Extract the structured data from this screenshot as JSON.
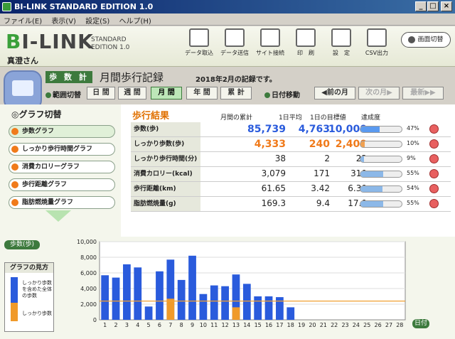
{
  "window": {
    "title": "BI-LINK STANDARD EDITION 1.0",
    "min": "_",
    "max": "□",
    "close": "×"
  },
  "menu": [
    "ファイル(E)",
    "表示(V)",
    "設定(S)",
    "ヘルプ(H)"
  ],
  "header": {
    "logo": "BI-LINK",
    "edition_line1": "STANDARD",
    "edition_line2": "EDITION 1.0",
    "user": "真澄さん",
    "tools": [
      "データ取込",
      "データ送信",
      "サイト接続",
      "印　刷",
      "設　定",
      "CSV出力"
    ],
    "screen_switch": "画面切替"
  },
  "page": {
    "label": "歩 数 計",
    "title": "月間歩行記録",
    "subtitle": "2018年2月の記録です。"
  },
  "range": {
    "label": "範囲切替",
    "tabs": [
      "日 間",
      "週 間",
      "月 間",
      "年 間",
      "累 計"
    ],
    "active": 2
  },
  "date_move": {
    "label": "日付移動",
    "prev": "前の月",
    "next": "次の月",
    "latest": "最新"
  },
  "graph_switch": {
    "title": "グラフ切替",
    "items": [
      "歩数グラフ",
      "しっかり歩行時間グラフ",
      "消費カロリーグラフ",
      "歩行距離グラフ",
      "脂肪燃焼量グラフ"
    ],
    "active": 0
  },
  "results": {
    "title": "歩行結果",
    "headers": [
      "月間の累計",
      "1日平均",
      "1日の目標値",
      "達成度"
    ],
    "rows": [
      {
        "name": "歩数(歩)",
        "total": "85,739",
        "avg": "4,763",
        "goal": "10,000",
        "pct": "47%",
        "fill": 0.47,
        "color": "#2a5bdc",
        "big": true
      },
      {
        "name": "しっかり歩数(歩)",
        "total": "4,333",
        "avg": "240",
        "goal": "2,400",
        "pct": "10%",
        "fill": 0.1,
        "color": "#f07a1a",
        "big": true
      },
      {
        "name": "しっかり歩行時間(分)",
        "total": "38",
        "avg": "2",
        "goal": "22",
        "pct": "9%",
        "fill": 0.09,
        "color": "#222",
        "big": false
      },
      {
        "name": "消費カロリー(kcal)",
        "total": "3,079",
        "avg": "171",
        "goal": "310",
        "pct": "55%",
        "fill": 0.55,
        "color": "#222",
        "big": false
      },
      {
        "name": "歩行距離(km)",
        "total": "61.65",
        "avg": "3.42",
        "goal": "6.30",
        "pct": "54%",
        "fill": 0.54,
        "color": "#222",
        "big": false
      },
      {
        "name": "脂肪燃焼量(g)",
        "total": "169.3",
        "avg": "9.4",
        "goal": "17.0",
        "pct": "55%",
        "fill": 0.55,
        "color": "#222",
        "big": false
      }
    ]
  },
  "chart_panel": {
    "label": "歩数(歩)",
    "legend_title": "グラフの見方",
    "legend_text1": "しっかり歩数を含めた全体の歩数",
    "legend_text2": "しっかり歩数",
    "x_label": "日付"
  },
  "chart_data": {
    "type": "bar",
    "categories": [
      "1",
      "2",
      "3",
      "4",
      "5",
      "6",
      "7",
      "8",
      "9",
      "10",
      "11",
      "12",
      "13",
      "14",
      "15",
      "16",
      "17",
      "18",
      "19",
      "20",
      "21",
      "22",
      "23",
      "24",
      "25",
      "26",
      "27",
      "28"
    ],
    "series": [
      {
        "values": [
          5700,
          5400,
          7100,
          6700,
          1700,
          6200,
          7700,
          5100,
          8200,
          3300,
          4400,
          4300,
          5800,
          4600,
          3000,
          3000,
          2900,
          1600,
          0,
          0,
          0,
          0,
          0,
          0,
          0,
          0,
          0,
          0
        ]
      },
      {
        "values": [
          0,
          0,
          0,
          0,
          0,
          0,
          2700,
          0,
          0,
          0,
          0,
          0,
          1600,
          0,
          0,
          0,
          0,
          0,
          0,
          0,
          0,
          0,
          0,
          0,
          0,
          0,
          0,
          0
        ]
      }
    ],
    "goal_line": 2400,
    "ylim": [
      0,
      10000
    ],
    "yticks": [
      "0",
      "2,000",
      "4,000",
      "6,000",
      "8,000",
      "10,000"
    ],
    "colors": {
      "total": "#2a5bdc",
      "firm": "#f09a2a",
      "goal": "#f0a030"
    }
  }
}
